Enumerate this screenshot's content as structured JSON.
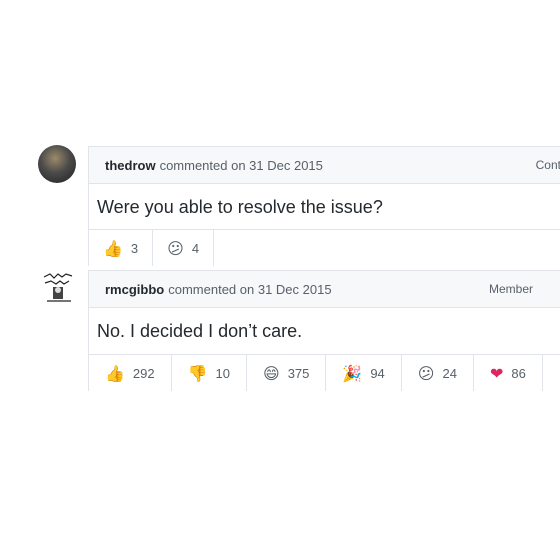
{
  "comments": [
    {
      "author": "thedrow",
      "meta": "commented on 31 Dec 2015",
      "badge": "Cont",
      "body": "Were you able to resolve the issue?",
      "reactions": [
        {
          "icon": "thumbs-up-icon",
          "glyph": "👍",
          "count": "3"
        },
        {
          "icon": "confused-face-icon",
          "glyph": "😕",
          "count": "4"
        }
      ]
    },
    {
      "author": "rmcgibbo",
      "meta": "commented on 31 Dec 2015",
      "badge": "Member",
      "body": "No. I decided I don’t care.",
      "reactions": [
        {
          "icon": "thumbs-up-icon",
          "glyph": "👍",
          "count": "292"
        },
        {
          "icon": "thumbs-down-icon",
          "glyph": "👎",
          "count": "10"
        },
        {
          "icon": "laugh-face-icon",
          "glyph": "😄",
          "count": "375"
        },
        {
          "icon": "party-popper-icon",
          "glyph": "🎉",
          "count": "94"
        },
        {
          "icon": "confused-face-icon",
          "glyph": "😕",
          "count": "24"
        },
        {
          "icon": "heart-icon",
          "glyph": "❤",
          "count": "86"
        }
      ]
    }
  ],
  "colors": {
    "border": "#e1e4e8",
    "header_bg": "#f6f8fa",
    "heart": "#e0245e",
    "thumb": "#f2b21b"
  }
}
